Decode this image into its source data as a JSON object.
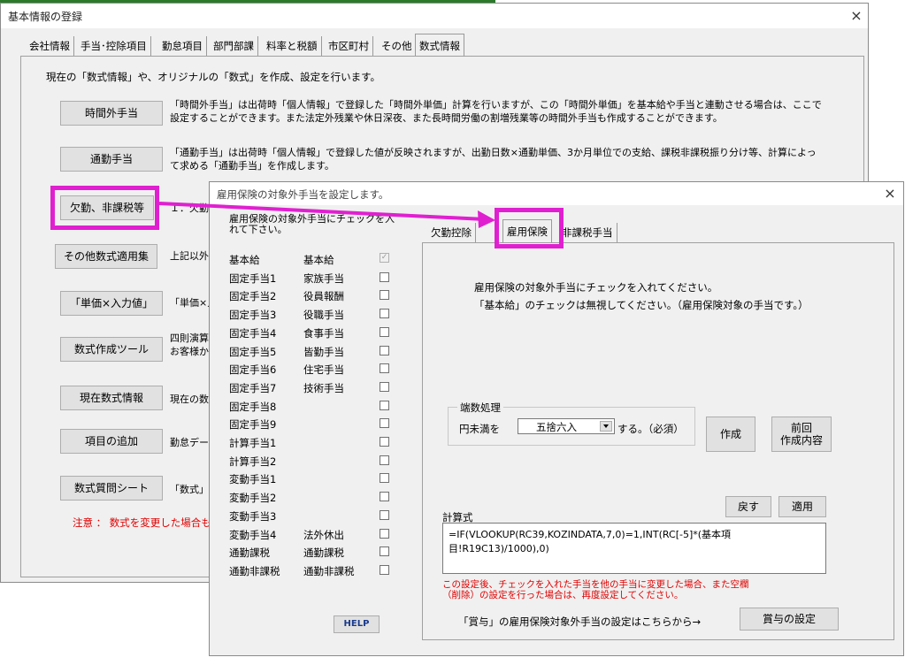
{
  "main_window": {
    "title": "基本情報の登録",
    "close": "×",
    "tabs": [
      "会社情報",
      "手当･控除項目",
      "勤怠項目",
      "部門部課",
      "料率と税額",
      "市区町村",
      "その他",
      "数式情報"
    ],
    "intro": "現在の「数式情報」や、オリジナルの「数式」を作成、設定を行います。",
    "rows": [
      {
        "button": "時間外手当",
        "desc": "「時間外手当」は出荷時「個人情報」で登録した「時間外単価」計算を行いますが、この「時間外単価」を基本給や手当と連動させる場合は、ここで設定することができます。また法定外残業や休日深夜、また長時間労働の割増残業等の時間外手当も作成することができます。"
      },
      {
        "button": "通勤手当",
        "desc": "「通勤手当」は出荷時「個人情報」で登録した値が反映されますが、出勤日数×通勤単価、3か月単位での支給、課税非課税振り分け等、計算によって求める「通勤手当」を作成します。"
      },
      {
        "button": "欠勤、非課税等",
        "desc": "１．欠勤"
      },
      {
        "button": "その他数式適用集",
        "desc": "上記以外"
      },
      {
        "button": "「単価×入力値」",
        "desc": "「単価×入"
      },
      {
        "button": "数式作成ツール",
        "desc": "四則演算\nお客様か"
      },
      {
        "button": "現在数式情報",
        "desc": "現在の数"
      },
      {
        "button": "項目の追加",
        "desc": "勤怠デー"
      },
      {
        "button": "数式質問シート",
        "desc": "「数式」を"
      }
    ],
    "notice": "注意 ： 数式を変更した場合も"
  },
  "dialog": {
    "title": "雇用保険の対象外手当を設定します。",
    "close": "×",
    "instruction": "雇用保険の対象外手当にチェックを入れて下さい。",
    "items": [
      {
        "code": "基本給",
        "name": "基本給",
        "checked": true,
        "disabled": true
      },
      {
        "code": "固定手当1",
        "name": "家族手当"
      },
      {
        "code": "固定手当2",
        "name": "役員報酬"
      },
      {
        "code": "固定手当3",
        "name": "役職手当"
      },
      {
        "code": "固定手当4",
        "name": "食事手当"
      },
      {
        "code": "固定手当5",
        "name": "皆勤手当"
      },
      {
        "code": "固定手当6",
        "name": "住宅手当"
      },
      {
        "code": "固定手当7",
        "name": "技術手当"
      },
      {
        "code": "固定手当8",
        "name": ""
      },
      {
        "code": "固定手当9",
        "name": ""
      },
      {
        "code": "計算手当1",
        "name": ""
      },
      {
        "code": "計算手当2",
        "name": ""
      },
      {
        "code": "変動手当1",
        "name": ""
      },
      {
        "code": "変動手当2",
        "name": ""
      },
      {
        "code": "変動手当3",
        "name": ""
      },
      {
        "code": "変動手当4",
        "name": "法外休出"
      },
      {
        "code": "通勤課税",
        "name": "通勤課税"
      },
      {
        "code": "通勤非課税",
        "name": "通勤非課税"
      }
    ],
    "help_label": "HELP",
    "tabs": [
      "欠勤控除",
      "雇用保険",
      "非課税手当"
    ],
    "tab_panel": {
      "line1": "雇用保険の対象外手当にチェックを入れてください。",
      "line2": "「基本給」のチェックは無視してください。（雇用保険対象の手当です。）",
      "rounding_group": "端数処理",
      "rounding_prefix": "円未満を",
      "rounding_value": "五捨六入",
      "rounding_suffix": "する。（必須）",
      "create_button": "作成",
      "previous_button": "前回\n作成内容",
      "back_button": "戻す",
      "apply_button": "適用",
      "formula_label": "計算式",
      "formula": "=IF(VLOOKUP(RC39,KOZINDATA,7,0)=1,INT(RC[-5]*(基本項目!R19C13)/1000),0)",
      "warning": "この設定後、チェックを入れた手当を他の手当に変更した場合、また空欄（削除）の設定を行った場合は、再度設定してください。",
      "bonus_text": "「賞与」の雇用保険対象外手当の設定はこちらから→",
      "bonus_button": "賞与の設定"
    }
  },
  "colors": {
    "highlight": "#e020d0",
    "warning": "#e00000",
    "help_text": "#1a3a8c"
  }
}
